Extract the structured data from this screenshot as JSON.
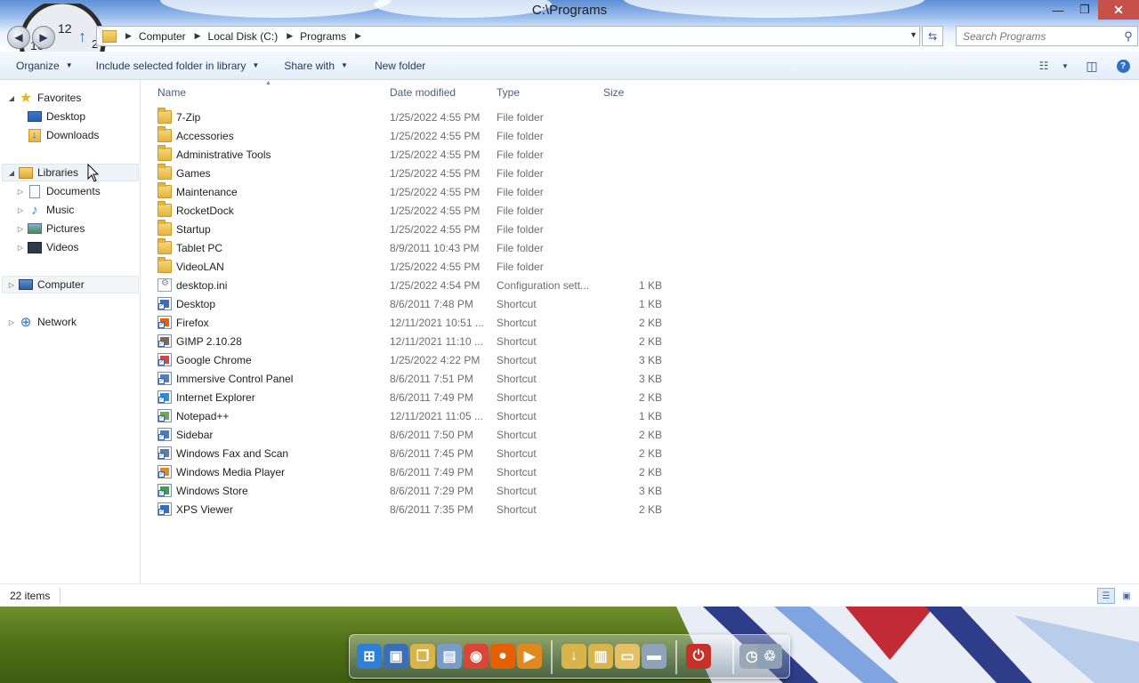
{
  "window": {
    "title": "C:\\Programs",
    "controls": {
      "minimize": "—",
      "restore": "❐",
      "close": "✕"
    }
  },
  "clock_gadget": {
    "numeral_top": "12",
    "numeral_left": "10",
    "numeral_right": "2"
  },
  "address": {
    "crumbs": [
      "Computer",
      "Local Disk (C:)",
      "Programs"
    ],
    "separator": "▶"
  },
  "search": {
    "placeholder": "Search Programs"
  },
  "commandbar": {
    "organize": "Organize",
    "include_library": "Include selected folder in library",
    "share_with": "Share with",
    "new_folder": "New folder",
    "dropdown_glyph": "▼",
    "help_glyph": "?"
  },
  "navpane": {
    "favorites": {
      "label": "Favorites",
      "items": [
        "Desktop",
        "Downloads"
      ]
    },
    "libraries": {
      "label": "Libraries",
      "items": [
        "Documents",
        "Music",
        "Pictures",
        "Videos"
      ]
    },
    "computer": {
      "label": "Computer"
    },
    "network": {
      "label": "Network"
    },
    "expanded_glyph": "◢",
    "collapsed_glyph": "▷"
  },
  "columns": {
    "name": "Name",
    "date": "Date modified",
    "type": "Type",
    "size": "Size",
    "sort_glyph": "▲"
  },
  "files": [
    {
      "name": "7-Zip",
      "date": "1/25/2022 4:55 PM",
      "type": "File folder",
      "size": "",
      "icon": "folder-icon"
    },
    {
      "name": "Accessories",
      "date": "1/25/2022 4:55 PM",
      "type": "File folder",
      "size": "",
      "icon": "folder-icon"
    },
    {
      "name": "Administrative Tools",
      "date": "1/25/2022 4:55 PM",
      "type": "File folder",
      "size": "",
      "icon": "folder-icon"
    },
    {
      "name": "Games",
      "date": "1/25/2022 4:55 PM",
      "type": "File folder",
      "size": "",
      "icon": "folder-icon"
    },
    {
      "name": "Maintenance",
      "date": "1/25/2022 4:55 PM",
      "type": "File folder",
      "size": "",
      "icon": "folder-icon"
    },
    {
      "name": "RocketDock",
      "date": "1/25/2022 4:55 PM",
      "type": "File folder",
      "size": "",
      "icon": "folder-icon"
    },
    {
      "name": "Startup",
      "date": "1/25/2022 4:55 PM",
      "type": "File folder",
      "size": "",
      "icon": "folder-icon"
    },
    {
      "name": "Tablet PC",
      "date": "8/9/2011 10:43 PM",
      "type": "File folder",
      "size": "",
      "icon": "folder-icon"
    },
    {
      "name": "VideoLAN",
      "date": "1/25/2022 4:55 PM",
      "type": "File folder",
      "size": "",
      "icon": "folder-icon"
    },
    {
      "name": "desktop.ini",
      "date": "1/25/2022 4:54 PM",
      "type": "Configuration sett...",
      "size": "1 KB",
      "icon": "config-file-icon"
    },
    {
      "name": "Desktop",
      "date": "8/6/2011 7:48 PM",
      "type": "Shortcut",
      "size": "1 KB",
      "icon": "desktop-shortcut-icon",
      "color": "#3a6cc0"
    },
    {
      "name": "Firefox",
      "date": "12/11/2021 10:51 ...",
      "type": "Shortcut",
      "size": "2 KB",
      "icon": "firefox-icon",
      "color": "#e66000"
    },
    {
      "name": "GIMP 2.10.28",
      "date": "12/11/2021 11:10 ...",
      "type": "Shortcut",
      "size": "2 KB",
      "icon": "gimp-icon",
      "color": "#7a6a50"
    },
    {
      "name": "Google Chrome",
      "date": "1/25/2022 4:22 PM",
      "type": "Shortcut",
      "size": "3 KB",
      "icon": "chrome-icon",
      "color": "#db4437"
    },
    {
      "name": "Immersive Control Panel",
      "date": "8/6/2011 7:51 PM",
      "type": "Shortcut",
      "size": "3 KB",
      "icon": "control-panel-icon",
      "color": "#4f7fc9"
    },
    {
      "name": "Internet Explorer",
      "date": "8/6/2011 7:49 PM",
      "type": "Shortcut",
      "size": "2 KB",
      "icon": "internet-explorer-icon",
      "color": "#2b8fd8"
    },
    {
      "name": "Notepad++",
      "date": "12/11/2021 11:05 ...",
      "type": "Shortcut",
      "size": "1 KB",
      "icon": "notepad-plus-plus-icon",
      "color": "#6da84a"
    },
    {
      "name": "Sidebar",
      "date": "8/6/2011 7:50 PM",
      "type": "Shortcut",
      "size": "2 KB",
      "icon": "sidebar-icon",
      "color": "#4c7bb8"
    },
    {
      "name": "Windows Fax and Scan",
      "date": "8/6/2011 7:45 PM",
      "type": "Shortcut",
      "size": "2 KB",
      "icon": "fax-scan-icon",
      "color": "#5a7ea8"
    },
    {
      "name": "Windows Media Player",
      "date": "8/6/2011 7:49 PM",
      "type": "Shortcut",
      "size": "2 KB",
      "icon": "media-player-icon",
      "color": "#e08a1e"
    },
    {
      "name": "Windows Store",
      "date": "8/6/2011 7:29 PM",
      "type": "Shortcut",
      "size": "3 KB",
      "icon": "store-icon",
      "color": "#3a9e4a"
    },
    {
      "name": "XPS Viewer",
      "date": "8/6/2011 7:35 PM",
      "type": "Shortcut",
      "size": "2 KB",
      "icon": "xps-viewer-icon",
      "color": "#2f6fc6"
    }
  ],
  "status": {
    "item_count": "22 items"
  },
  "dock": {
    "items": [
      {
        "name": "windows-start-icon",
        "glyph": "⊞",
        "color": "#2f7fd6"
      },
      {
        "name": "computer-icon",
        "glyph": "▣",
        "color": "#3d6eb5"
      },
      {
        "name": "folder-pair-icon",
        "glyph": "❐",
        "color": "#d9b44a"
      },
      {
        "name": "document-icon",
        "glyph": "▤",
        "color": "#7a9cc8"
      },
      {
        "name": "chrome-icon",
        "glyph": "◉",
        "color": "#db4437"
      },
      {
        "name": "firefox-icon",
        "glyph": "●",
        "color": "#e66000"
      },
      {
        "name": "media-player-icon",
        "glyph": "▶",
        "color": "#e08a1e"
      },
      {
        "name": "downloads-folder-icon",
        "glyph": "↓",
        "color": "#d9b44a"
      },
      {
        "name": "documents-folder-icon",
        "glyph": "▥",
        "color": "#d9b44a"
      },
      {
        "name": "open-folder-icon",
        "glyph": "▭",
        "color": "#e4c067"
      },
      {
        "name": "drive-icon",
        "glyph": "▬",
        "color": "#8fa3b8"
      },
      {
        "name": "power-icon",
        "glyph": "⏻",
        "color": "#c8312a"
      },
      {
        "name": "clock-icon",
        "glyph": "◷",
        "color": "#9aa7b5"
      },
      {
        "name": "recycle-bin-icon",
        "glyph": "♲",
        "color": "#8ea0b4"
      }
    ]
  }
}
